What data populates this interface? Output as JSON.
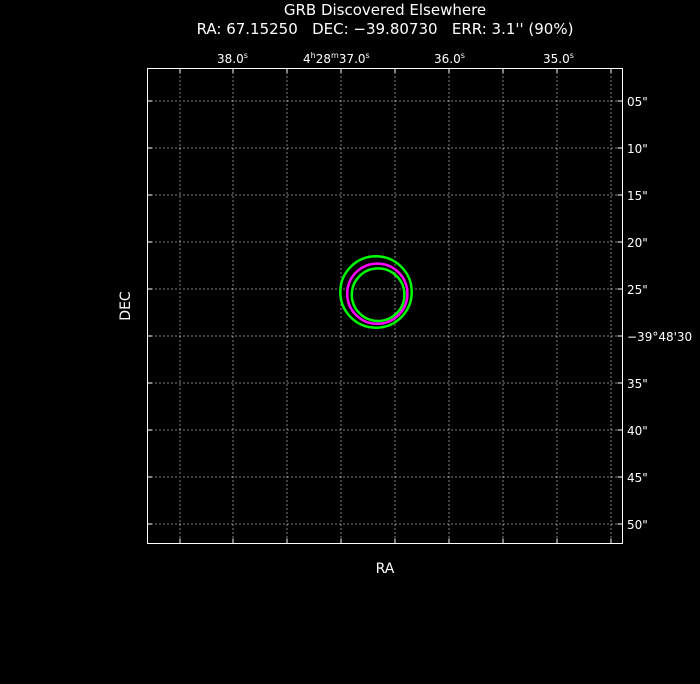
{
  "header": {
    "title": "GRB Discovered Elsewhere",
    "subtitle": "RA: 67.15250   DEC: −39.80730   ERR: 3.1'' (90%)"
  },
  "chart_data": {
    "type": "scatter",
    "title": "GRB Discovered Elsewhere",
    "subtitle": "RA: 67.15250   DEC: −39.80730   ERR: 3.1'' (90%)",
    "xlabel": "RA",
    "ylabel": "DEC",
    "grid": true,
    "x_tick_labels": [
      {
        "label": "38.0",
        "unit": "s"
      },
      {
        "label": "37.0",
        "unit": "s",
        "prefix_h": "4",
        "prefix_m": "28"
      },
      {
        "label": "36.0",
        "unit": "s"
      },
      {
        "label": "35.0",
        "unit": "s"
      }
    ],
    "y_tick_labels": [
      "05\"",
      "10\"",
      "15\"",
      "20\"",
      "25\"",
      "−39°48'30",
      "35\"",
      "40\"",
      "45\"",
      "50\""
    ],
    "error_circles": [
      {
        "ra": 67.1525,
        "dec": -39.8073,
        "radius_arcsec": 3.8,
        "color": "#00ff00"
      },
      {
        "ra": 67.15245,
        "dec": -39.80735,
        "radius_arcsec": 3.2,
        "color": "#ff00ff"
      },
      {
        "ra": 67.15242,
        "dec": -39.80738,
        "radius_arcsec": 2.8,
        "color": "#00ff00"
      }
    ],
    "colors": {
      "background": "#000000",
      "axes": "#ffffff",
      "grid": "#ffffff"
    }
  }
}
